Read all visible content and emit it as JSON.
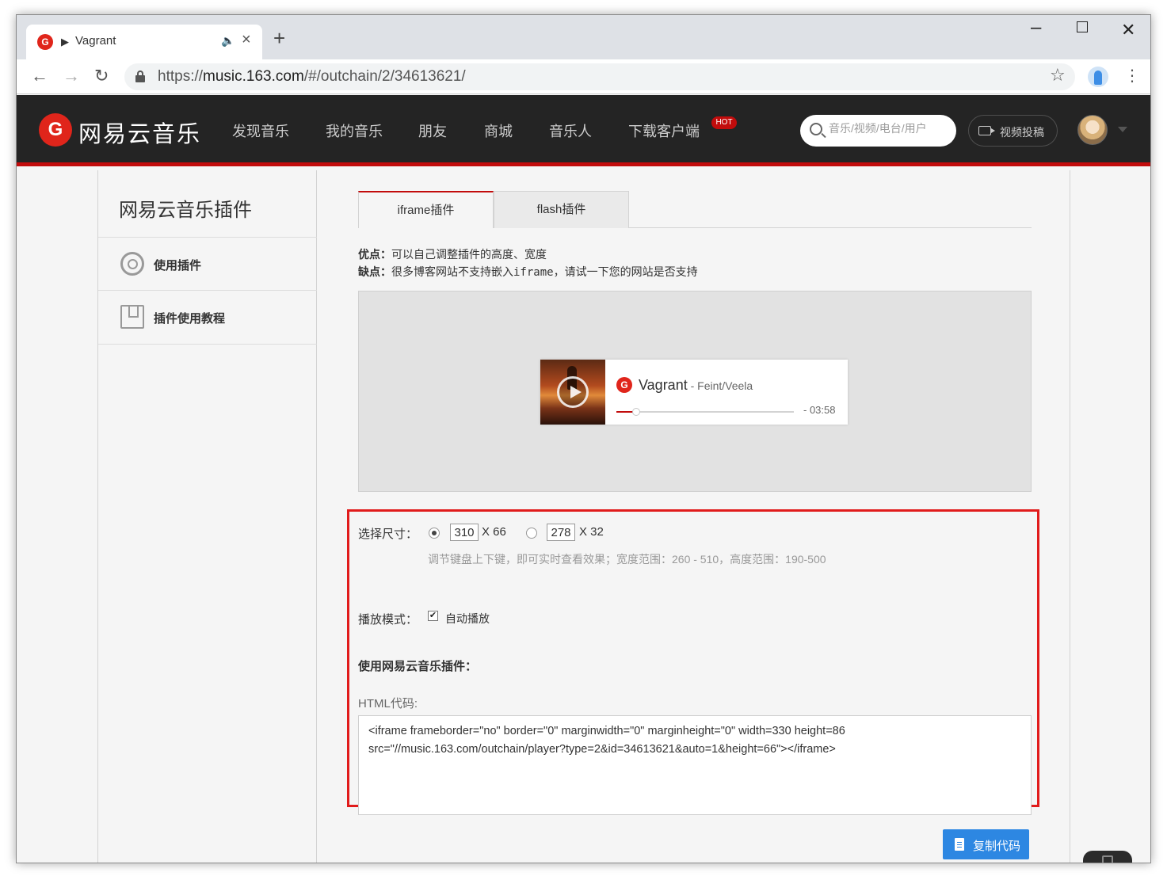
{
  "browser": {
    "tab_title": "Vagrant",
    "tab_play_icon": "▶",
    "url_prefix": "https://",
    "url_host": "music.163.com",
    "url_path": "/#/outchain/2/34613621/"
  },
  "header": {
    "logo_text": "网易云音乐",
    "nav": [
      "发现音乐",
      "我的音乐",
      "朋友",
      "商城",
      "音乐人",
      "下载客户端"
    ],
    "hot_badge": "HOT",
    "search_placeholder": "音乐/视频/电台/用户",
    "upload_label": "视频投稿"
  },
  "sidebar": {
    "title": "网易云音乐插件",
    "items": [
      {
        "label": "使用插件",
        "icon": "gear-icon"
      },
      {
        "label": "插件使用教程",
        "icon": "book-icon"
      }
    ]
  },
  "main": {
    "tabs": [
      {
        "label": "iframe插件",
        "active": true
      },
      {
        "label": "flash插件",
        "active": false
      }
    ],
    "pros_label": "优点：",
    "pros_text": "可以自己调整插件的高度、宽度",
    "cons_label": "缺点：",
    "cons_text": "很多博客网站不支持嵌入iframe，请试一下您的网站是否支持"
  },
  "player": {
    "song": "Vagrant",
    "artist": " - Feint/Veela",
    "duration": "- 03:58",
    "progress": 0.11
  },
  "options": {
    "size_label": "选择尺寸：",
    "size_large_width": "310",
    "size_large_height": "X 66",
    "size_small_width": "278",
    "size_small_height": "X 32",
    "selected": "large",
    "hint": "调节键盘上下键，即可实时查看效果；宽度范围：260 - 510，高度范围：190-500",
    "mode_label": "播放模式：",
    "autoplay_label": "自动播放",
    "autoplay_checked": true,
    "use_label": "使用网易云音乐插件：",
    "html_label": "HTML代码:",
    "code": "<iframe frameborder=\"no\" border=\"0\" marginwidth=\"0\" marginheight=\"0\" width=330 height=86\nsrc=\"//music.163.com/outchain/player?type=2&id=34613621&auto=1&height=66\"></iframe>"
  },
  "copy_button": "复制代码"
}
